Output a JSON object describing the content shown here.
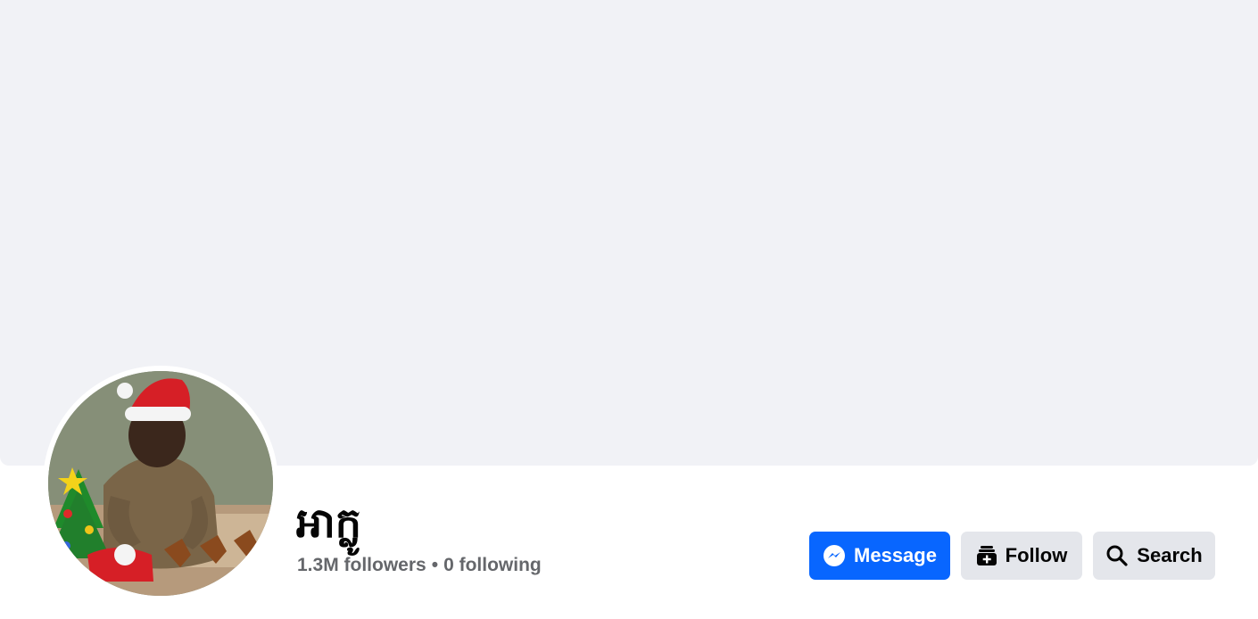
{
  "profile": {
    "name": "អាក្លូ",
    "followers": "1.3M followers",
    "separator": "•",
    "following": "0 following"
  },
  "actions": {
    "message_label": "Message",
    "follow_label": "Follow",
    "search_label": "Search"
  },
  "icons": {
    "message": "messenger-icon",
    "follow": "follow-icon",
    "search": "search-icon"
  },
  "colors": {
    "primary": "#0866ff",
    "secondary_button": "#e4e6eb",
    "cover": "#f1f2f6",
    "muted_text": "#65676b"
  }
}
